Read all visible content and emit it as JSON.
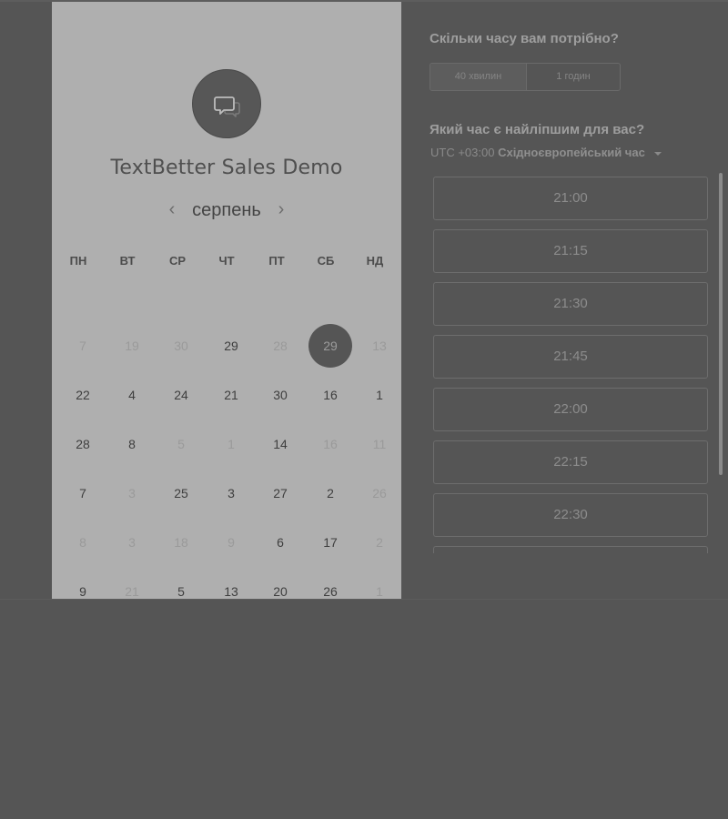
{
  "calendar": {
    "company_name": "TextBetter Sales Demo",
    "logo_icon": "chat-bubble-icon",
    "month": "серпень",
    "prev_glyph": "‹",
    "next_glyph": "›",
    "weekdays": [
      "ПН",
      "ВТ",
      "СР",
      "ЧТ",
      "ПТ",
      "СБ",
      "НД"
    ],
    "weeks": [
      [
        {
          "text": "7",
          "muted": true
        },
        {
          "text": "19",
          "muted": true
        },
        {
          "text": "30",
          "muted": true
        },
        {
          "text": "29",
          "muted": false
        },
        {
          "text": "28",
          "muted": true
        },
        {
          "text": "29",
          "muted": false,
          "selected": true
        },
        {
          "text": "13",
          "muted": true
        }
      ],
      [
        {
          "text": "22",
          "muted": false
        },
        {
          "text": "4",
          "muted": false
        },
        {
          "text": "24",
          "muted": false
        },
        {
          "text": "21",
          "muted": false
        },
        {
          "text": "30",
          "muted": false
        },
        {
          "text": "16",
          "muted": false
        },
        {
          "text": "1",
          "muted": false
        }
      ],
      [
        {
          "text": "28",
          "muted": false
        },
        {
          "text": "8",
          "muted": false
        },
        {
          "text": "5",
          "muted": true
        },
        {
          "text": "1",
          "muted": true
        },
        {
          "text": "14",
          "muted": false
        },
        {
          "text": "16",
          "muted": true
        },
        {
          "text": "11",
          "muted": true
        }
      ],
      [
        {
          "text": "7",
          "muted": false
        },
        {
          "text": "3",
          "muted": true
        },
        {
          "text": "25",
          "muted": false
        },
        {
          "text": "3",
          "muted": false
        },
        {
          "text": "27",
          "muted": false
        },
        {
          "text": "2",
          "muted": false
        },
        {
          "text": "26",
          "muted": true
        }
      ],
      [
        {
          "text": "8",
          "muted": true
        },
        {
          "text": "3",
          "muted": true
        },
        {
          "text": "18",
          "muted": true
        },
        {
          "text": "9",
          "muted": true
        },
        {
          "text": "6",
          "muted": false
        },
        {
          "text": "17",
          "muted": false
        },
        {
          "text": "2",
          "muted": true
        }
      ],
      [
        {
          "text": "9",
          "muted": false
        },
        {
          "text": "21",
          "muted": true
        },
        {
          "text": "5",
          "muted": false
        },
        {
          "text": "13",
          "muted": false
        },
        {
          "text": "20",
          "muted": false
        },
        {
          "text": "26",
          "muted": false
        },
        {
          "text": "1",
          "muted": true
        }
      ]
    ]
  },
  "duration": {
    "title": "Скільки часу вам потрібно?",
    "options": [
      "40 хвилин",
      "1 годин"
    ],
    "selected": "40 хвилин"
  },
  "time": {
    "title": "Який час є найліпшим для вас?",
    "timezone_offset": "UTC +03:00",
    "timezone_name": "Східноєвропейський час",
    "slots": [
      "21:00",
      "21:15",
      "21:30",
      "21:45",
      "22:00",
      "22:15",
      "22:30",
      ""
    ]
  },
  "colors": {
    "page_background": "#555555",
    "calendar_panel": "#afafaf",
    "selected_day": "#555555"
  }
}
